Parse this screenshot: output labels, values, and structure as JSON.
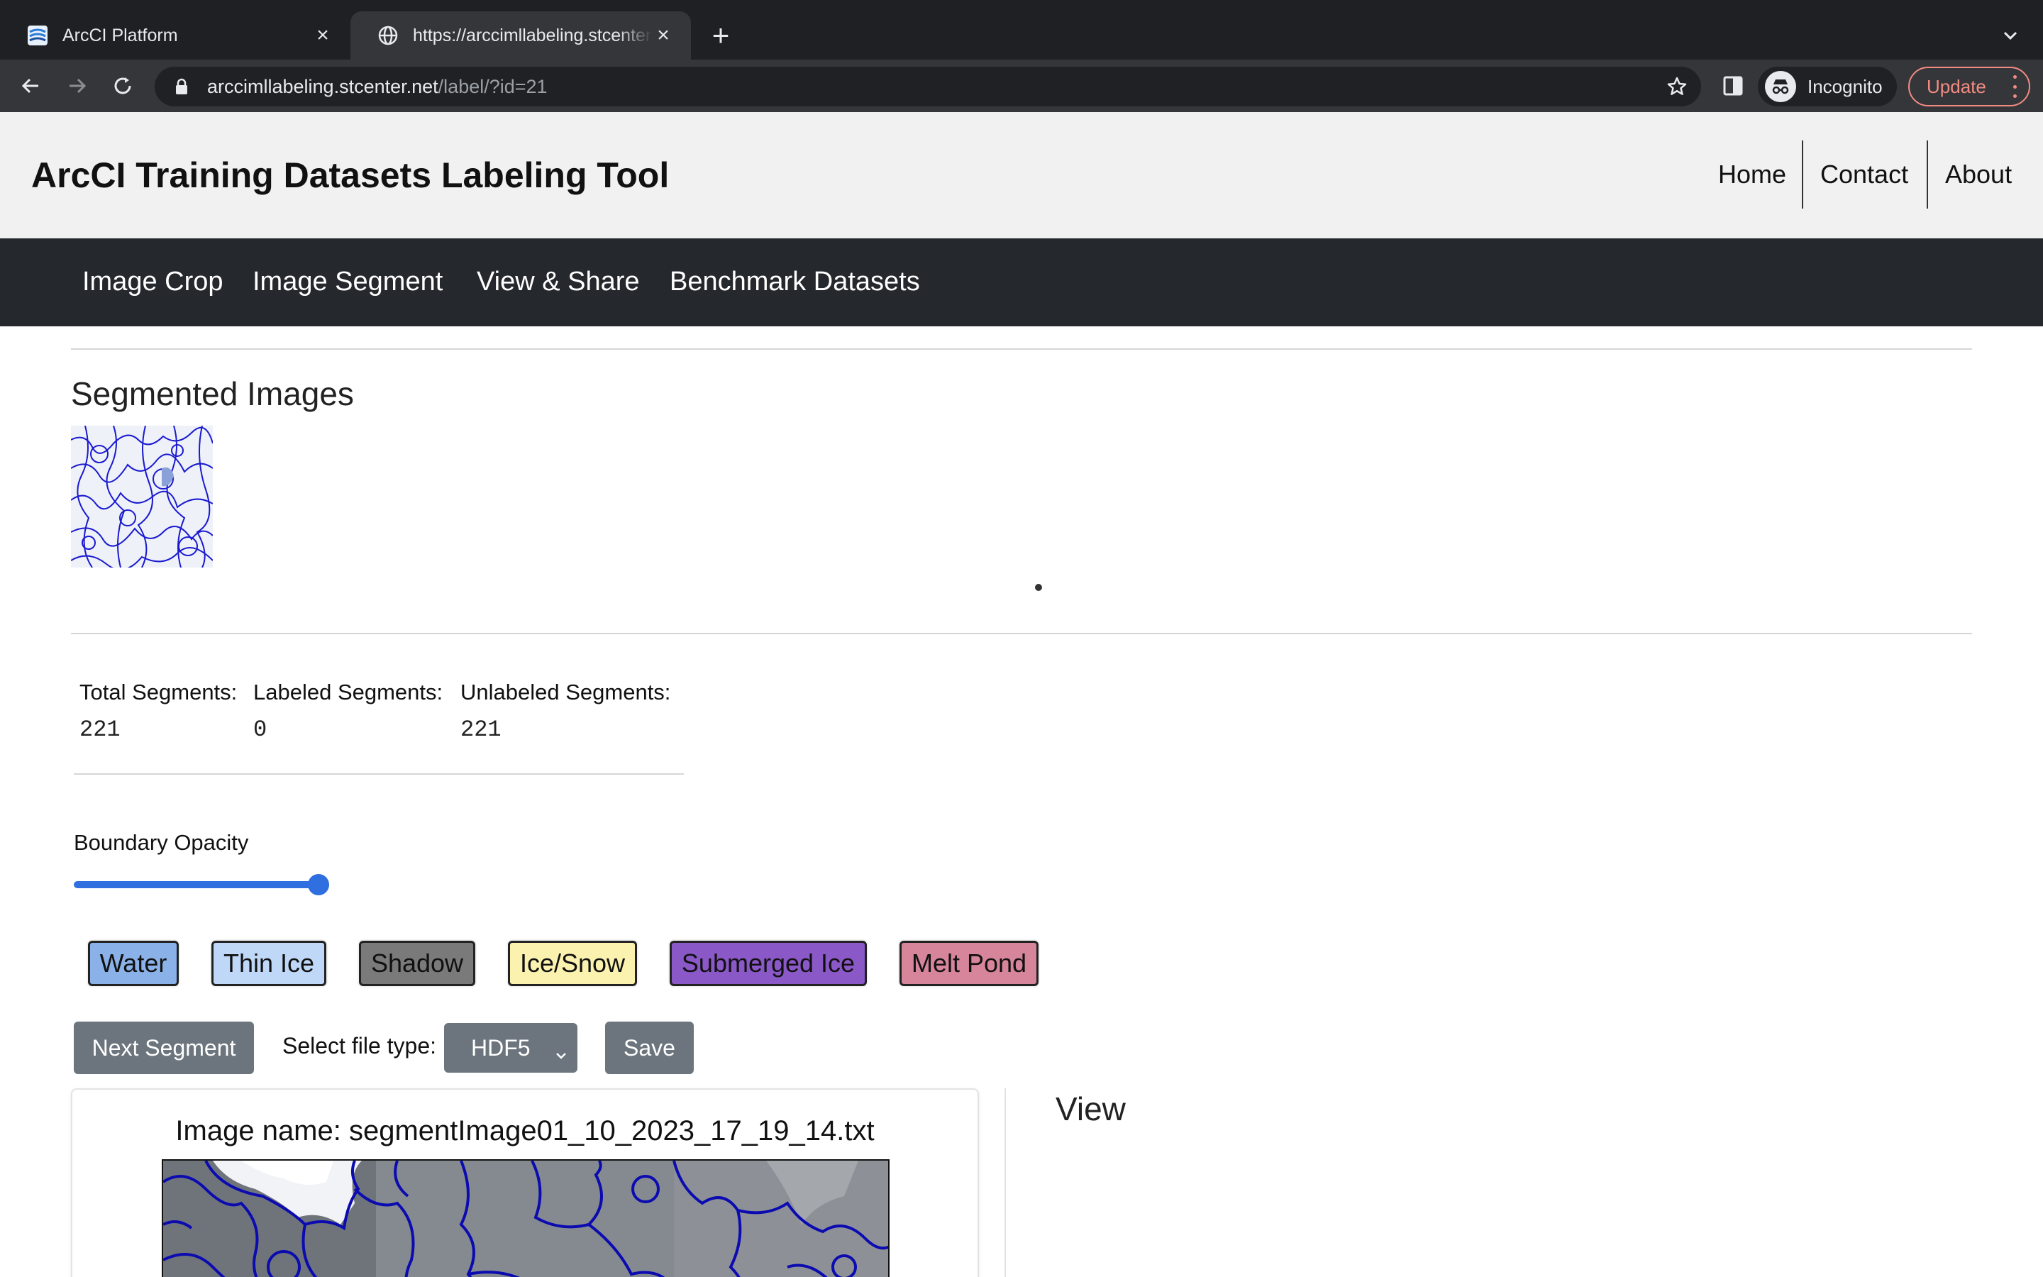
{
  "browser": {
    "tabs": [
      {
        "title": "ArcCI Platform",
        "active": false
      },
      {
        "title": "https://arccimllabeling.stcenter.net/label/?id=21",
        "active": true
      }
    ],
    "url_host": "arccimllabeling.stcenter.net",
    "url_path": "/label/?id=21",
    "profile_label": "Incognito",
    "update_label": "Update"
  },
  "header": {
    "title": "ArcCI Training Datasets Labeling Tool",
    "links": [
      "Home",
      "Contact",
      "About"
    ]
  },
  "nav": {
    "items": [
      "Image Crop",
      "Image Segment",
      "View & Share",
      "Benchmark Datasets"
    ]
  },
  "segmented": {
    "title": "Segmented Images"
  },
  "stats": {
    "total_label": "Total Segments:",
    "total_value": "221",
    "labeled_label": "Labeled Segments:",
    "labeled_value": "0",
    "unlabeled_label": "Unlabeled Segments:",
    "unlabeled_value": "221"
  },
  "opacity": {
    "label": "Boundary Opacity",
    "value_fraction": 1.0
  },
  "labels": [
    {
      "name": "Water",
      "color": "#8ab2e8"
    },
    {
      "name": "Thin Ice",
      "color": "#bfd8f7"
    },
    {
      "name": "Shadow",
      "color": "#7a7a7a"
    },
    {
      "name": "Ice/Snow",
      "color": "#fbf2b0"
    },
    {
      "name": "Submerged Ice",
      "color": "#8b58c8"
    },
    {
      "name": "Melt Pond",
      "color": "#d7859b"
    }
  ],
  "controls": {
    "next_label": "Next Segment",
    "filetype_label": "Select file type:",
    "filetype_value": "HDF5",
    "save_label": "Save"
  },
  "image_card": {
    "name": "Image name: segmentImage01_10_2023_17_19_14.txt"
  },
  "view": {
    "title": "View"
  }
}
